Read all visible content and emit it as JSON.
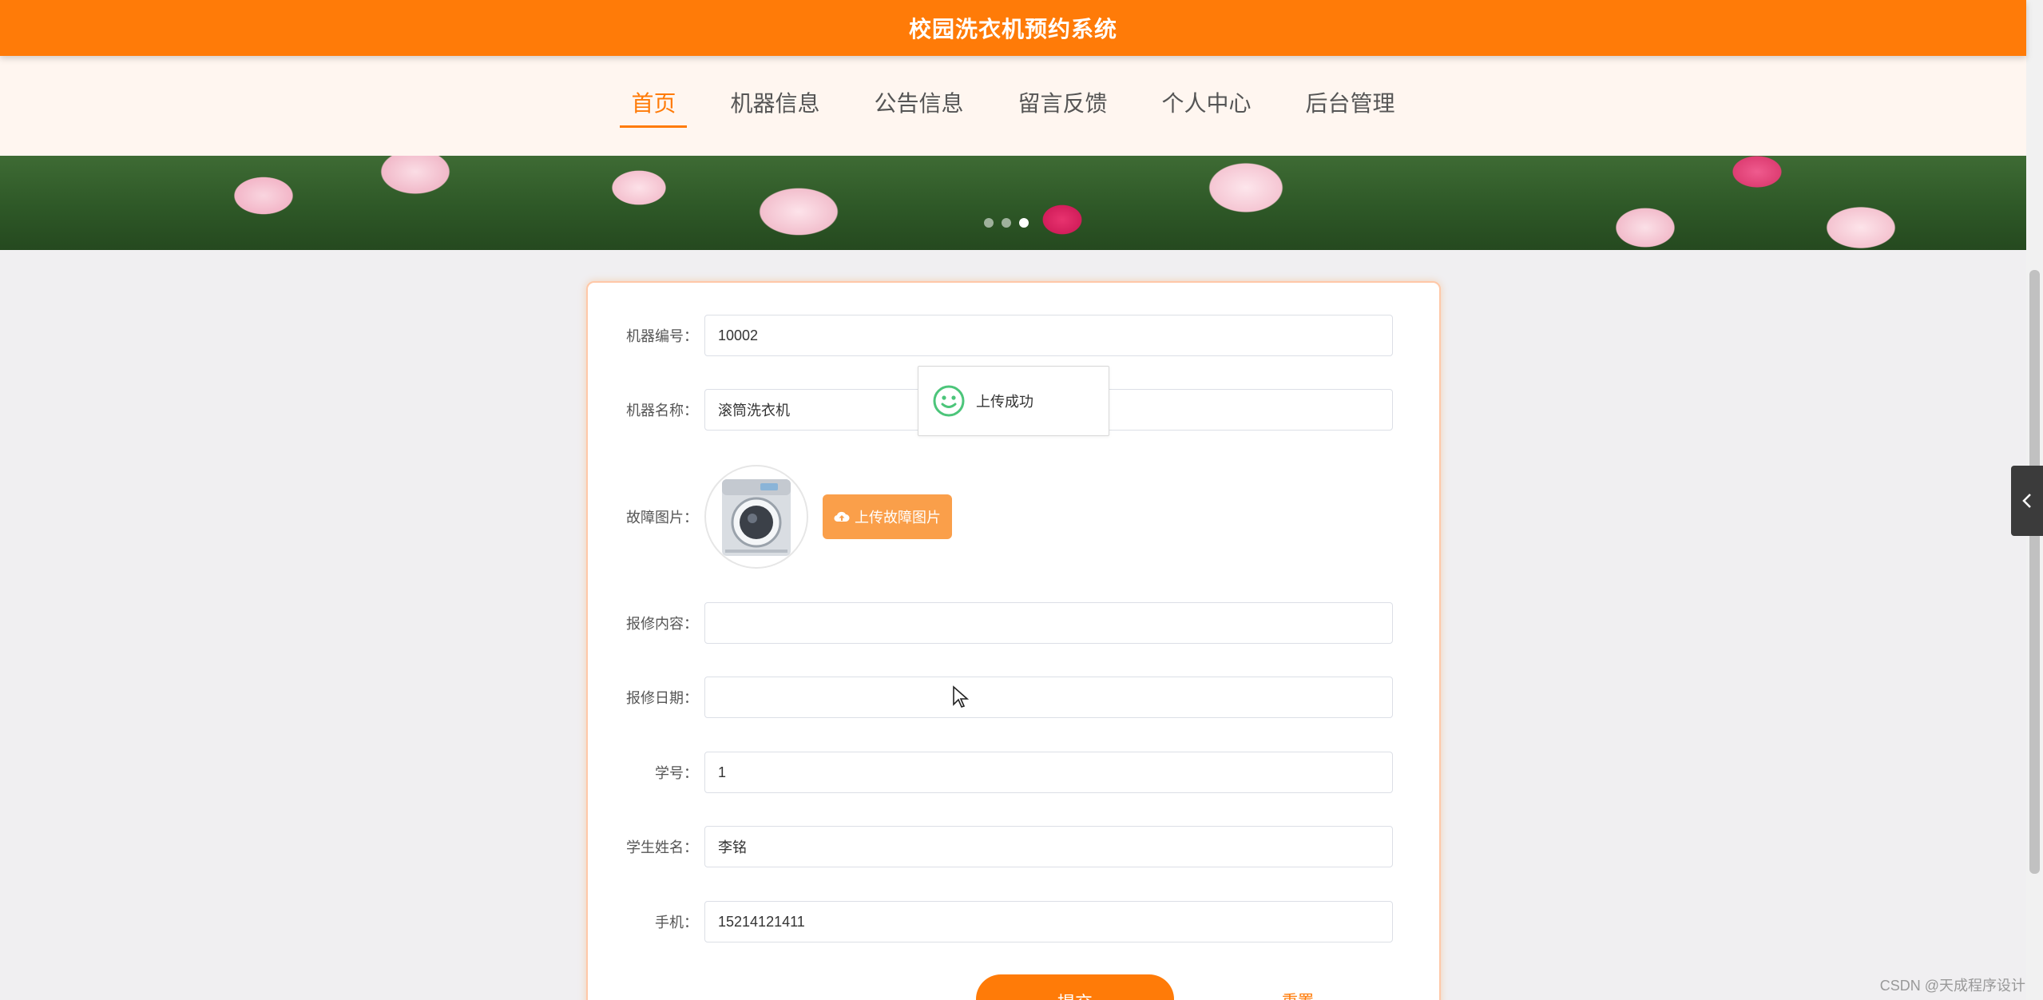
{
  "header": {
    "title": "校园洗衣机预约系统",
    "bg_color": "#ff7b08"
  },
  "nav": {
    "items": [
      {
        "label": "首页",
        "active": true
      },
      {
        "label": "机器信息",
        "active": false
      },
      {
        "label": "公告信息",
        "active": false
      },
      {
        "label": "留言反馈",
        "active": false
      },
      {
        "label": "个人中心",
        "active": false
      },
      {
        "label": "后台管理",
        "active": false
      }
    ]
  },
  "carousel": {
    "dot_count": 3,
    "active_dot": 3
  },
  "form": {
    "machine_no": {
      "label": "机器编号：",
      "value": "10002"
    },
    "machine_name": {
      "label": "机器名称：",
      "value": "滚筒洗衣机"
    },
    "fault_image": {
      "label": "故障图片：",
      "upload_button": "上传故障图片"
    },
    "repair_content": {
      "label": "报修内容：",
      "value": ""
    },
    "repair_date": {
      "label": "报修日期：",
      "value": ""
    },
    "student_id": {
      "label": "学号：",
      "value": "1"
    },
    "student_name": {
      "label": "学生姓名：",
      "value": "李铭"
    },
    "phone": {
      "label": "手机：",
      "value": "15214121411"
    },
    "submit_label": "提交",
    "reset_label": "重置"
  },
  "toast": {
    "message": "上传成功",
    "icon": "smile-icon"
  },
  "watermark": "CSDN @天成程序设计"
}
